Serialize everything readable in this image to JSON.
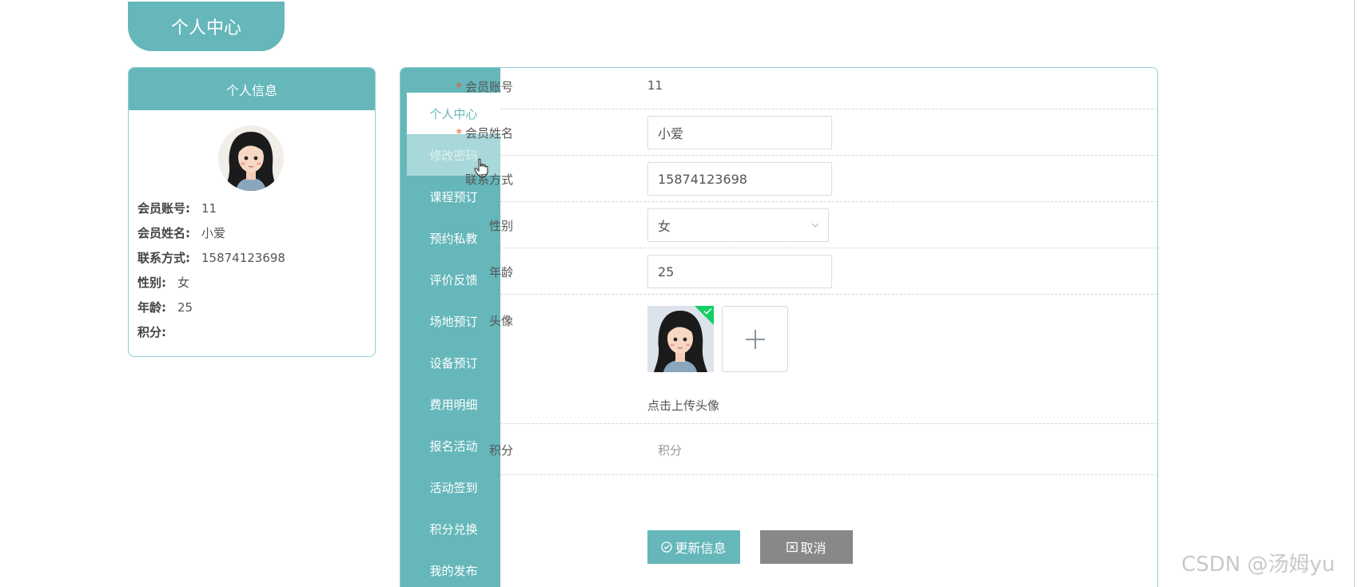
{
  "page_title": "个人中心",
  "info_card": {
    "title": "个人信息",
    "rows": [
      {
        "label": "会员账号:",
        "value": "11"
      },
      {
        "label": "会员姓名:",
        "value": "小爱"
      },
      {
        "label": "联系方式:",
        "value": "15874123698"
      },
      {
        "label": "性别:",
        "value": "女"
      },
      {
        "label": "年龄:",
        "value": "25"
      },
      {
        "label": "积分:",
        "value": ""
      }
    ]
  },
  "menu": {
    "items": [
      "个人中心",
      "修改密码",
      "课程预订",
      "预约私教",
      "评价反馈",
      "场地预订",
      "设备预订",
      "费用明细",
      "报名活动",
      "活动签到",
      "积分兑换",
      "我的发布"
    ],
    "active": "个人中心",
    "hovered": "修改密码"
  },
  "form": {
    "account_label": "会员账号",
    "account_value": "11",
    "name_label": "会员姓名",
    "name_value": "小爱",
    "phone_label": "联系方式",
    "phone_value": "15874123698",
    "gender_label": "性别",
    "gender_value": "女",
    "age_label": "年龄",
    "age_value": "25",
    "avatar_label": "头像",
    "upload_hint": "点击上传头像",
    "points_label": "积分",
    "points_placeholder": "积分",
    "required_mark": "*"
  },
  "buttons": {
    "update": "更新信息",
    "cancel": "取消"
  },
  "watermark": "CSDN @汤姆yu",
  "colors": {
    "accent": "#65b7ba",
    "cancel": "#888888",
    "required": "#e85b3a",
    "success": "#13ce66"
  }
}
